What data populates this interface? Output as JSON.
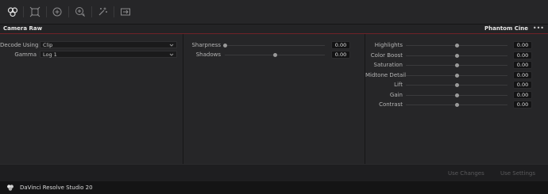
{
  "toolbar": {
    "icons": [
      "camera-raw-icon",
      "sizing-icon",
      "add-node-icon",
      "add-serial-node-icon",
      "magic-mask-icon",
      "image-wipe-icon"
    ]
  },
  "panel": {
    "title": "Camera Raw",
    "source": "Phantom Cine",
    "menu": "•••"
  },
  "decode": {
    "decode_using_label": "Decode Using",
    "decode_using_value": "Clip",
    "gamma_label": "Gamma",
    "gamma_value": "Log 1"
  },
  "middle_sliders": [
    {
      "label": "Sharpness",
      "value": "0.00",
      "level": 0.0
    },
    {
      "label": "Shadows",
      "value": "0.00",
      "level": 0.5
    }
  ],
  "right_sliders": [
    {
      "label": "Highlights",
      "value": "0.00",
      "level": 0.5
    },
    {
      "label": "Color Boost",
      "value": "0.00",
      "level": 0.5
    },
    {
      "label": "Saturation",
      "value": "0.00",
      "level": 0.5
    },
    {
      "label": "Midtone Detail",
      "value": "0.00",
      "level": 0.5
    },
    {
      "label": "Lift",
      "value": "0.00",
      "level": 0.5
    },
    {
      "label": "Gain",
      "value": "0.00",
      "level": 0.5
    },
    {
      "label": "Contrast",
      "value": "0.00",
      "level": 0.5
    }
  ],
  "footer": {
    "use_changes": "Use Changes",
    "use_settings": "Use Settings"
  },
  "status": {
    "app_name": "DaVinci Resolve Studio 20"
  },
  "colors": {
    "accent_line": "#6e2228",
    "panel_bg": "#262628"
  }
}
